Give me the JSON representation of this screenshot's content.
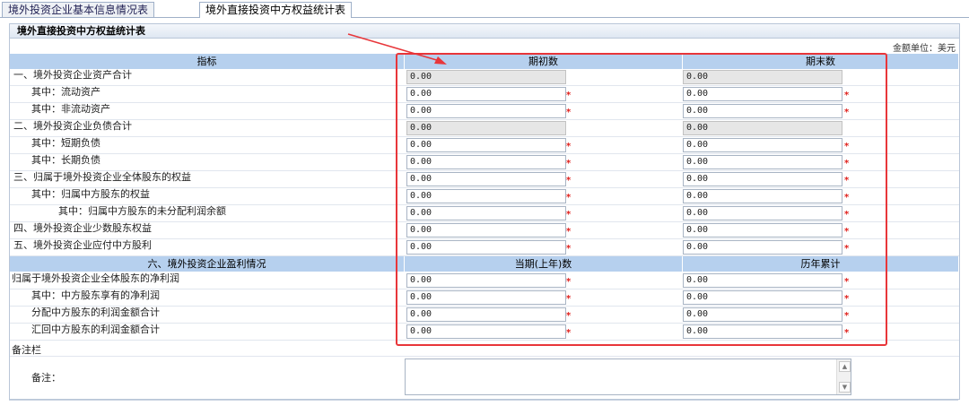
{
  "tabs": [
    {
      "label": "境外投资企业基本信息情况表",
      "active": false
    },
    {
      "label": "境外直接投资中方权益统计表",
      "active": true
    }
  ],
  "panel_title": "境外直接投资中方权益统计表",
  "unit_label": "金额单位：美元",
  "headers": {
    "indicator": "指标",
    "begin": "期初数",
    "end": "期末数",
    "section6": "六、境外投资企业盈利情况",
    "current": "当期(上年)数",
    "cumulative": "历年累计"
  },
  "rows": [
    {
      "label": "一、境外投资企业资产合计",
      "begin": "0.00",
      "end": "0.00",
      "readonly": true
    },
    {
      "label": "其中：流动资产",
      "begin": "0.00",
      "end": "0.00",
      "readonly": false
    },
    {
      "label": "其中：非流动资产",
      "begin": "0.00",
      "end": "0.00",
      "readonly": false
    },
    {
      "label": "二、境外投资企业负债合计",
      "begin": "0.00",
      "end": "0.00",
      "readonly": true
    },
    {
      "label": "其中：短期负债",
      "begin": "0.00",
      "end": "0.00",
      "readonly": false
    },
    {
      "label": "其中：长期负债",
      "begin": "0.00",
      "end": "0.00",
      "readonly": false
    },
    {
      "label": "三、归属于境外投资企业全体股东的权益",
      "begin": "0.00",
      "end": "0.00",
      "readonly": false
    },
    {
      "label": "其中：归属中方股东的权益",
      "begin": "0.00",
      "end": "0.00",
      "readonly": false
    },
    {
      "label": "其中：归属中方股东的未分配利润余额",
      "begin": "0.00",
      "end": "0.00",
      "readonly": false
    },
    {
      "label": "四、境外投资企业少数股东权益",
      "begin": "0.00",
      "end": "0.00",
      "readonly": false
    },
    {
      "label": "五、境外投资企业应付中方股利",
      "begin": "0.00",
      "end": "0.00",
      "readonly": false
    }
  ],
  "profit_rows": [
    {
      "label": "归属于境外投资企业全体股东的净利润",
      "current": "0.00",
      "cumulative": "0.00"
    },
    {
      "label": "其中：中方股东享有的净利润",
      "current": "0.00",
      "cumulative": "0.00"
    },
    {
      "label": "分配中方股东的利润金额合计",
      "current": "0.00",
      "cumulative": "0.00"
    },
    {
      "label": "汇回中方股东的利润金额合计",
      "current": "0.00",
      "cumulative": "0.00"
    }
  ],
  "required_mark": "*",
  "memo_section": "备注栏",
  "memo_label": "备注：",
  "memo_value": "",
  "colors": {
    "header_bg": "#b6d0ee",
    "required": "#e0201c",
    "highlight": "#e8363a",
    "readonly_bg": "#e6e6e6"
  }
}
